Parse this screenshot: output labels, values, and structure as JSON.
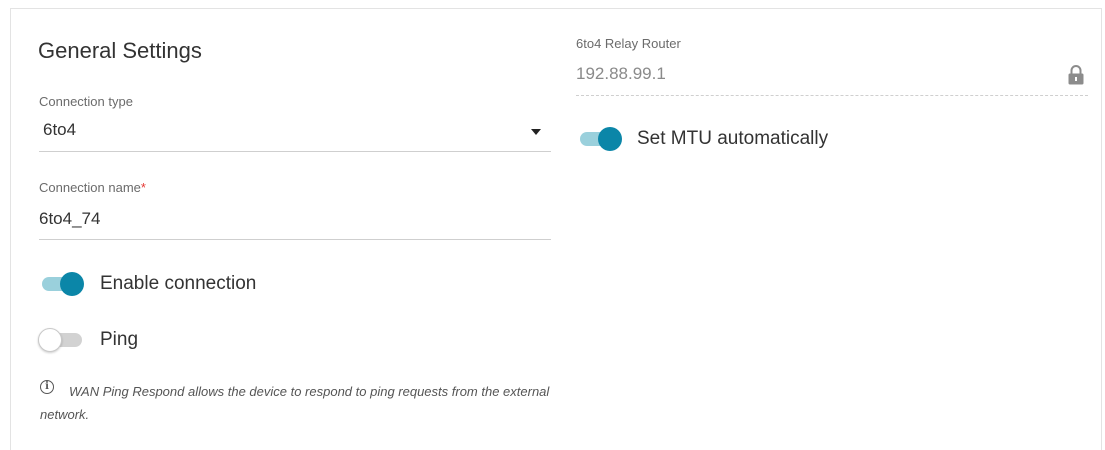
{
  "general": {
    "title": "General Settings",
    "connection_type": {
      "label": "Connection type",
      "value": "6to4"
    },
    "connection_name": {
      "label": "Connection name",
      "required_mark": "*",
      "value": "6to4_74"
    },
    "enable_connection": {
      "label": "Enable connection",
      "enabled": true
    },
    "ping": {
      "label": "Ping",
      "enabled": false
    },
    "info": {
      "icon": "info-icon",
      "text": "WAN Ping Respond allows the device to respond to ping requests from the external network."
    }
  },
  "relay": {
    "label": "6to4 Relay Router",
    "value": "192.88.99.1",
    "locked": true,
    "icon": "lock-icon"
  },
  "mtu": {
    "label": "Set MTU automatically",
    "enabled": true
  },
  "colors": {
    "accent": "#0b86a8",
    "accent_track": "#9ad0dc",
    "required": "#e53935"
  }
}
